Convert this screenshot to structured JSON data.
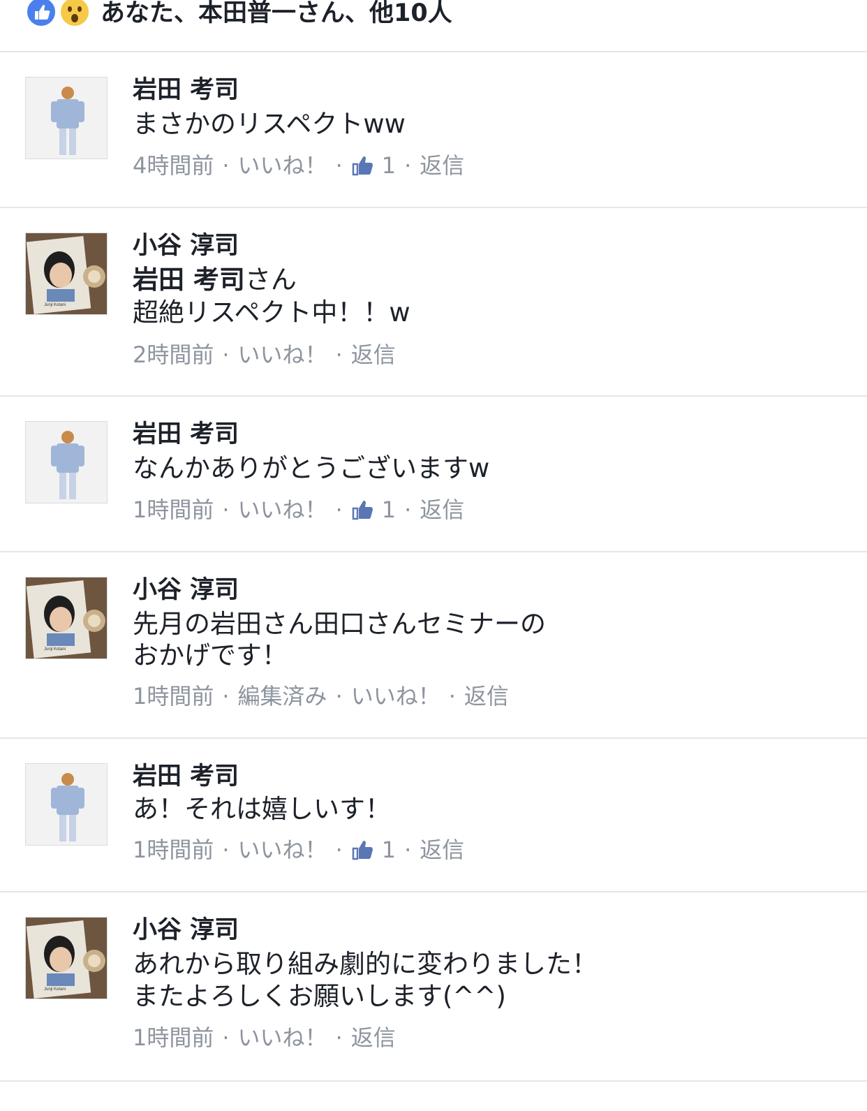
{
  "reactions": {
    "summary": "あなた、本田普一さん、他10人",
    "icons": [
      "like-icon",
      "wow-icon"
    ]
  },
  "comments": [
    {
      "author": "岩田 考司",
      "lines": [
        "まさかのリスペクトww"
      ],
      "time": "4時間前",
      "edited": "",
      "like_label": "いいね！",
      "like_count": "1",
      "reply_label": "返信"
    },
    {
      "author": "小谷 淳司",
      "mention": "岩田 考司",
      "mention_suffix": "さん",
      "lines": [
        "超絶リスペクト中！！w"
      ],
      "time": "2時間前",
      "like_label": "いいね！",
      "reply_label": "返信"
    },
    {
      "author": "岩田 考司",
      "lines": [
        "なんかありがとうございますw"
      ],
      "time": "1時間前",
      "like_label": "いいね！",
      "like_count": "1",
      "reply_label": "返信"
    },
    {
      "author": "小谷 淳司",
      "lines": [
        "先月の岩田さん田口さんセミナーの",
        "おかげです！"
      ],
      "time": "1時間前",
      "edited": "編集済み",
      "like_label": "いいね！",
      "reply_label": "返信"
    },
    {
      "author": "岩田 考司",
      "lines": [
        "あ！それは嬉しいす！"
      ],
      "time": "1時間前",
      "like_label": "いいね！",
      "like_count": "1",
      "reply_label": "返信"
    },
    {
      "author": "小谷 淳司",
      "lines": [
        "あれから取り組み劇的に変わりました！",
        "またよろしくお願いします(^^)"
      ],
      "time": "1時間前",
      "like_label": "いいね！",
      "reply_label": "返信"
    }
  ],
  "avatar_caption": "Junji Kotani",
  "colors": {
    "text": "#1d2129",
    "meta": "#8d949e",
    "like_blue": "#4a7fee",
    "wow_yellow": "#f7c948",
    "divider": "#e4e6eb"
  }
}
